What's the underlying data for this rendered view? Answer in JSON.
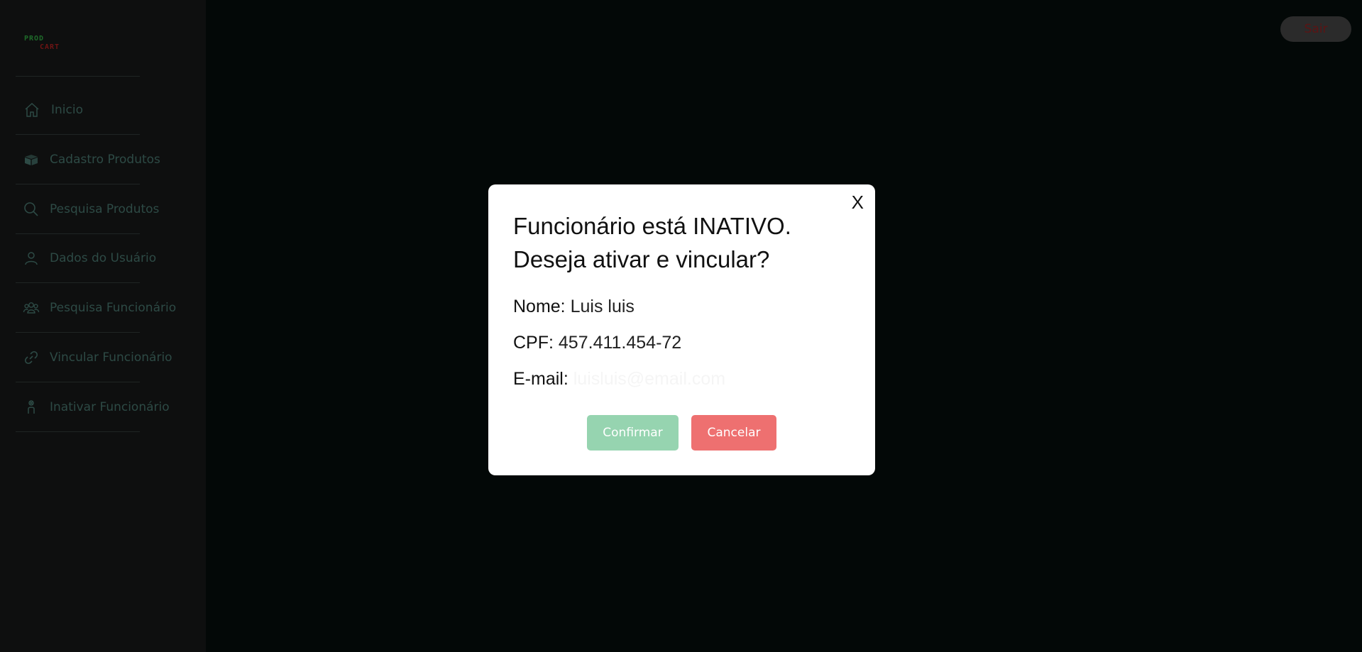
{
  "logo": {
    "line1": "PROD",
    "line2": "CART"
  },
  "sidebar": {
    "items": [
      {
        "label": "Inicio",
        "icon": "home-icon"
      },
      {
        "label": "Cadastro Produtos",
        "icon": "box-icon"
      },
      {
        "label": "Pesquisa Produtos",
        "icon": "search-icon"
      },
      {
        "label": "Dados do Usuário",
        "icon": "user-icon"
      },
      {
        "label": "Pesquisa Funcionário",
        "icon": "users-icon"
      },
      {
        "label": "Vincular Funcionário",
        "icon": "link-icon"
      },
      {
        "label": "Inativar Funcionário",
        "icon": "user-off-icon"
      }
    ]
  },
  "header": {
    "logout_label": "Sair"
  },
  "modal": {
    "close_label": "X",
    "title": "Funcionário está INATIVO. Deseja ativar e vincular?",
    "fields": {
      "name_label": "Nome:",
      "name_value": "Luis luis",
      "cpf_label": "CPF:",
      "cpf_value": "457.411.454-72",
      "email_label": "E-mail:",
      "email_value": "luisluis@email.com"
    },
    "confirm_label": "Confirmar",
    "cancel_label": "Cancelar"
  },
  "colors": {
    "overlay": "#030807",
    "sidebar": "#0e0f0f",
    "confirm": "#96d4b0",
    "cancel": "#ee7070",
    "logout_bg": "#2b2b2b"
  }
}
